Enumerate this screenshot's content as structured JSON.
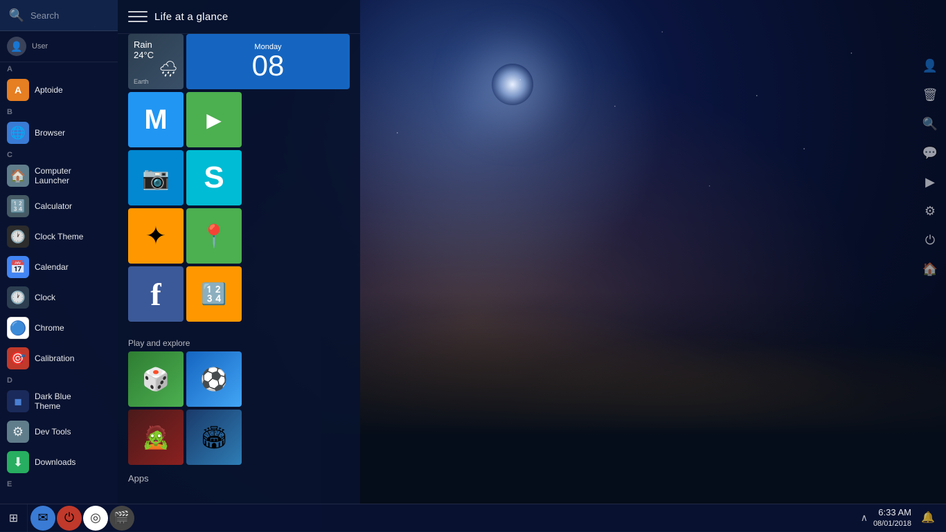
{
  "app": {
    "title": "Computer Launcher"
  },
  "search": {
    "placeholder": "Search",
    "label": "Search"
  },
  "panel": {
    "title": "Life at a glance",
    "hamburger_label": "Menu"
  },
  "weather_tile": {
    "condition": "Rain",
    "temp": "24°C",
    "icon": "🌧",
    "label": "Earth"
  },
  "calendar_tile": {
    "day": "Monday",
    "date": "08"
  },
  "sections": {
    "life_at_a_glance": "Life at a glance",
    "play_and_explore": "Play and explore",
    "apps": "Apps"
  },
  "app_tiles": [
    {
      "name": "Gmail",
      "icon": "✉",
      "color": "#2196f3"
    },
    {
      "name": "Play Store",
      "icon": "▶",
      "color": "#4caf50"
    },
    {
      "name": "Camera",
      "icon": "📷",
      "color": "#0288d1"
    },
    {
      "name": "Skype",
      "icon": "S",
      "color": "#00bcd4"
    },
    {
      "name": "Google Photos",
      "icon": "✦",
      "color": "#ff9800"
    },
    {
      "name": "Google Maps",
      "icon": "📍",
      "color": "#4caf50"
    },
    {
      "name": "Facebook",
      "icon": "f",
      "color": "#3b5998"
    },
    {
      "name": "Calculator",
      "icon": "🔢",
      "color": "#ff9800"
    }
  ],
  "games": [
    {
      "name": "Board Game",
      "icon": "🎲"
    },
    {
      "name": "Soccer",
      "icon": "⚽"
    },
    {
      "name": "Zombie Game",
      "icon": "🧟"
    },
    {
      "name": "Sports",
      "icon": "🏟"
    }
  ],
  "sidebar_items": [
    {
      "id": "user",
      "name": "User",
      "alpha": "A",
      "icon": "👤",
      "color": "#607d8b"
    },
    {
      "id": "aptoide",
      "name": "Aptoide",
      "icon": "A",
      "color": "#e67e22"
    },
    {
      "id": "browser",
      "name": "Browser",
      "alpha": "B",
      "icon": "🌐",
      "color": "#3a7bd5"
    },
    {
      "id": "computer-launcher",
      "name": "Computer Launcher",
      "alpha": "C",
      "icon": "🏠",
      "color": "#607d8b"
    },
    {
      "id": "calculator",
      "name": "Calculator",
      "icon": "🔢",
      "color": "#455a64"
    },
    {
      "id": "clock-theme",
      "name": "Clock Theme",
      "icon": "🕐",
      "color": "#2c2c2c"
    },
    {
      "id": "calendar",
      "name": "Calendar",
      "icon": "📅",
      "color": "#4285f4"
    },
    {
      "id": "clock",
      "name": "Clock",
      "icon": "🕐",
      "color": "#2c3e50"
    },
    {
      "id": "chrome",
      "name": "Chrome",
      "icon": "◎",
      "color": "#ffffff"
    },
    {
      "id": "calibration",
      "name": "Calibration",
      "icon": "🎯",
      "color": "#c0392b"
    },
    {
      "id": "dark-blue-theme",
      "name": "Dark Blue Theme",
      "alpha": "D",
      "icon": "◼",
      "color": "#1a2a5a"
    },
    {
      "id": "dev-tools",
      "name": "Dev Tools",
      "icon": "⚙",
      "color": "#607d8b"
    },
    {
      "id": "downloads",
      "name": "Downloads",
      "icon": "⬇",
      "color": "#27ae60"
    },
    {
      "id": "e",
      "alpha": "E",
      "icon": "",
      "color": "transparent"
    }
  ],
  "taskbar": {
    "apps": [
      {
        "id": "grid",
        "icon": "⊞"
      },
      {
        "id": "mail",
        "icon": "✉"
      },
      {
        "id": "power",
        "icon": "⏻"
      },
      {
        "id": "chrome",
        "icon": "◎"
      },
      {
        "id": "media",
        "icon": "🎬"
      }
    ],
    "time": "6:33 AM",
    "date": "08/01/2018",
    "chevron": "∧"
  },
  "right_strip": {
    "icons": [
      "👤",
      "📺",
      "🔔",
      "⚙",
      "⏻",
      "🏠"
    ]
  }
}
